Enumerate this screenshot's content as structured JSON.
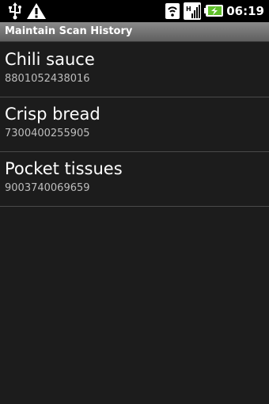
{
  "status_bar": {
    "time": "06:19",
    "icons": [
      "usb-icon",
      "warning-icon",
      "sync-icon",
      "signal-icon",
      "battery-charging-icon"
    ]
  },
  "header": {
    "title": "Maintain Scan History"
  },
  "history": {
    "items": [
      {
        "name": "Chili sauce",
        "code": "8801052438016"
      },
      {
        "name": "Crisp bread",
        "code": "7300400255905"
      },
      {
        "name": "Pocket tissues",
        "code": "9003740069659"
      }
    ]
  },
  "colors": {
    "background": "#1c1c1c",
    "status_bar": "#000000",
    "title_bar": "#707070",
    "divider": "#4a4a4a",
    "battery_accent": "#5fbf2a"
  }
}
